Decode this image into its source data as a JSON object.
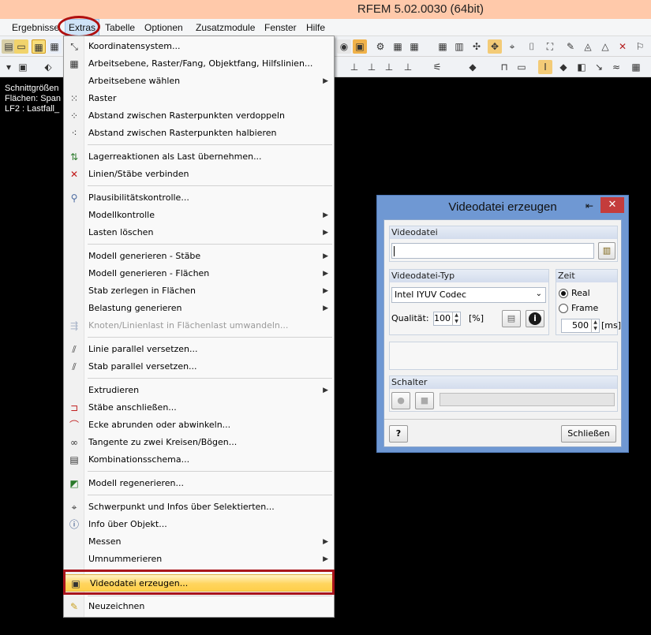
{
  "window": {
    "title": "RFEM 5.02.0030 (64bit)"
  },
  "menubar": {
    "items": [
      {
        "label": "Ergebnisse"
      },
      {
        "label": "Extras"
      },
      {
        "label": "Tabelle"
      },
      {
        "label": "Optionen"
      },
      {
        "label": "Zusatzmodule"
      },
      {
        "label": "Fenster"
      },
      {
        "label": "Hilfe"
      }
    ]
  },
  "panel": {
    "lines": [
      "Schnittgrößen",
      "Flächen: Span",
      "LF2 : Lastfall_"
    ]
  },
  "extras_menu": {
    "items": [
      {
        "label": "Koordinatensystem...",
        "icon": "coordinate-system-icon"
      },
      {
        "label": "Arbeitsebene, Raster/Fang, Objektfang, Hilfslinien...",
        "icon": "grid-settings-icon"
      },
      {
        "label": "Arbeitsebene wählen",
        "submenu": true
      },
      {
        "label": "Raster",
        "icon": "grid-icon"
      },
      {
        "label": "Abstand zwischen Rasterpunkten verdoppeln",
        "icon": "grid-double-icon"
      },
      {
        "label": "Abstand zwischen Rasterpunkten halbieren",
        "icon": "grid-half-icon"
      },
      {
        "label": "Lagerreaktionen als Last übernehmen...",
        "icon": "support-reactions-icon"
      },
      {
        "label": "Linien/Stäbe verbinden",
        "icon": "connect-lines-icon"
      },
      {
        "label": "Plausibilitätskontrolle...",
        "icon": "check-icon"
      },
      {
        "label": "Modellkontrolle",
        "submenu": true
      },
      {
        "label": "Lasten löschen",
        "submenu": true
      },
      {
        "label": "Modell generieren - Stäbe",
        "submenu": true
      },
      {
        "label": "Modell generieren - Flächen",
        "submenu": true
      },
      {
        "label": "Stab zerlegen in Flächen",
        "submenu": true
      },
      {
        "label": "Belastung generieren",
        "submenu": true
      },
      {
        "label": "Knoten/Linienlast in Flächenlast umwandeln...",
        "icon": "convert-load-icon",
        "disabled": true
      },
      {
        "label": "Linie parallel versetzen...",
        "icon": "offset-line-icon"
      },
      {
        "label": "Stab parallel versetzen...",
        "icon": "offset-member-icon"
      },
      {
        "label": "Extrudieren",
        "submenu": true
      },
      {
        "label": "Stäbe anschließen...",
        "icon": "connect-members-icon"
      },
      {
        "label": "Ecke abrunden oder abwinkeln...",
        "icon": "round-corner-icon"
      },
      {
        "label": "Tangente zu zwei Kreisen/Bögen...",
        "icon": "tangent-icon"
      },
      {
        "label": "Kombinationsschema...",
        "icon": "combination-scheme-icon"
      },
      {
        "label": "Modell regenerieren...",
        "icon": "regenerate-icon"
      },
      {
        "label": "Schwerpunkt und Infos über Selektierten...",
        "icon": "centroid-icon"
      },
      {
        "label": "Info über Objekt...",
        "icon": "info-icon"
      },
      {
        "label": "Messen",
        "submenu": true
      },
      {
        "label": "Umnummerieren",
        "submenu": true
      },
      {
        "label": "Videodatei erzeugen...",
        "icon": "video-file-icon",
        "highlighted": true
      },
      {
        "label": "Neuzeichnen",
        "icon": "pencil-icon"
      }
    ]
  },
  "dialog": {
    "title": "Videodatei erzeugen",
    "close_glyph": "✕",
    "pin_glyph": "⇤",
    "videodatei": {
      "label": "Videodatei",
      "value": ""
    },
    "type": {
      "label": "Videodatei-Typ",
      "selected": "Intel IYUV Codec",
      "quality_label": "Qualität:",
      "quality_value": "100",
      "quality_unit": "[%]"
    },
    "time": {
      "label": "Zeit",
      "options": [
        "Real",
        "Frame"
      ],
      "selected": "Real",
      "ms_value": "500",
      "ms_unit": "[ms]"
    },
    "schalter": {
      "label": "Schalter"
    },
    "close_button": "Schließen"
  }
}
